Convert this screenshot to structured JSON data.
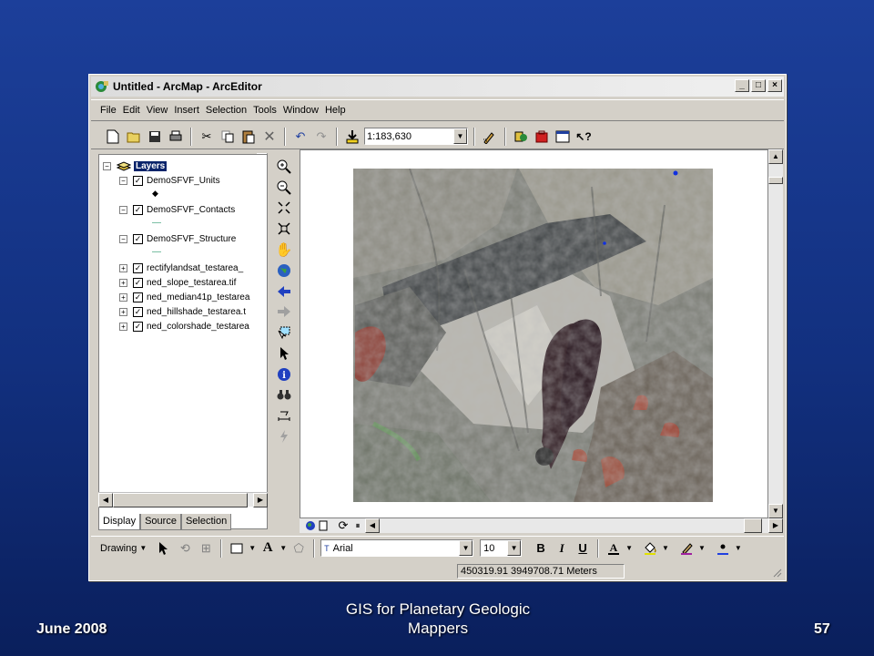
{
  "window": {
    "title": "Untitled - ArcMap - ArcEditor",
    "controls": {
      "minimize": "_",
      "maximize": "□",
      "close": "×"
    }
  },
  "menu": [
    "File",
    "Edit",
    "View",
    "Insert",
    "Selection",
    "Tools",
    "Window",
    "Help"
  ],
  "toolbar": {
    "scale": "1:183,630"
  },
  "toc": {
    "root": "Layers",
    "layers": [
      {
        "name": "DemoSFVF_Units",
        "symbol": "◆"
      },
      {
        "name": "DemoSFVF_Contacts",
        "symbol": "—"
      },
      {
        "name": "DemoSFVF_Structure",
        "symbol": "—"
      },
      {
        "name": "rectifylandsat_testarea_"
      },
      {
        "name": "ned_slope_testarea.tif"
      },
      {
        "name": "ned_median41p_testarea"
      },
      {
        "name": "ned_hillshade_testarea.t"
      },
      {
        "name": "ned_colorshade_testarea"
      }
    ],
    "tabs": [
      "Display",
      "Source",
      "Selection"
    ]
  },
  "drawing": {
    "label": "Drawing",
    "font": "Arial",
    "size": "10",
    "bold": "B",
    "italic": "I",
    "underline": "U",
    "text_tool": "A"
  },
  "status": {
    "coords": "450319.91  3949708.71 Meters"
  },
  "slide": {
    "date": "June 2008",
    "title": "GIS for Planetary Geologic Mappers",
    "page": "57"
  },
  "colors": {
    "slide_bg": "#1c3f9a",
    "window_bg": "#d4d0c8",
    "contact_line": "#3aa07a"
  }
}
